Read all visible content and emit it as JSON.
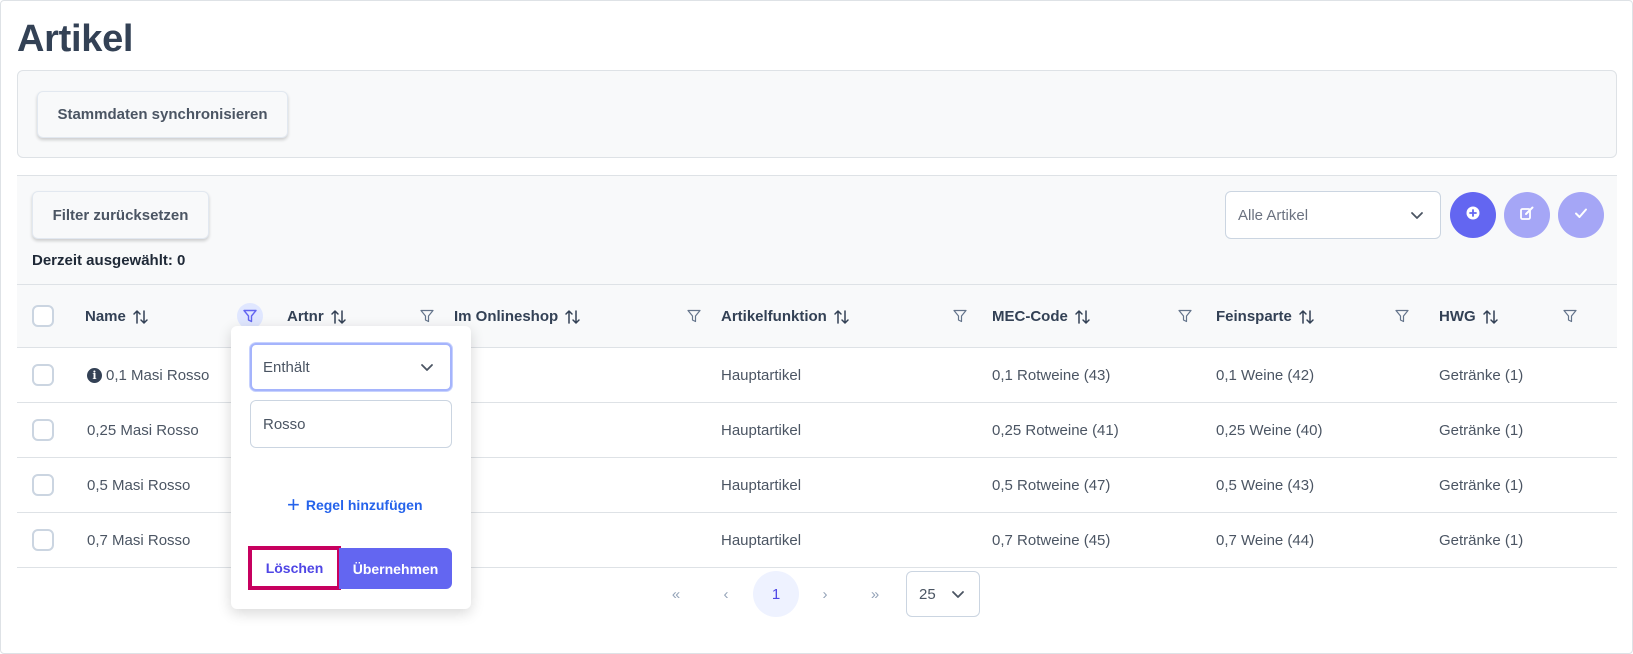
{
  "page": {
    "title": "Artikel"
  },
  "toolbar": {
    "sync_label": "Stammdaten synchronisieren"
  },
  "table_controls": {
    "reset_filter_label": "Filter zurücksetzen",
    "selected_text": "Derzeit ausgewählt: 0",
    "view_select": {
      "value": "Alle Artikel"
    },
    "action_buttons": [
      "add-icon",
      "edit-icon",
      "check-icon"
    ]
  },
  "columns": [
    {
      "key": "name",
      "label": "Name"
    },
    {
      "key": "artnr",
      "label": "Artnr"
    },
    {
      "key": "onlineshop",
      "label": "Im Onlineshop"
    },
    {
      "key": "funktion",
      "label": "Artikelfunktion"
    },
    {
      "key": "mec",
      "label": "MEC-Code"
    },
    {
      "key": "feinsparte",
      "label": "Feinsparte"
    },
    {
      "key": "hwg",
      "label": "HWG"
    }
  ],
  "rows": [
    {
      "name": "0,1 Masi Rosso",
      "has_info": true,
      "artnr": "",
      "onlineshop": "",
      "funktion": "Hauptartikel",
      "mec": "0,1 Rotweine (43)",
      "feinsparte": "0,1 Weine (42)",
      "hwg": "Getränke (1)"
    },
    {
      "name": "0,25 Masi Rosso",
      "has_info": false,
      "artnr": "",
      "onlineshop": "",
      "funktion": "Hauptartikel",
      "mec": "0,25 Rotweine (41)",
      "feinsparte": "0,25 Weine (40)",
      "hwg": "Getränke (1)"
    },
    {
      "name": "0,5 Masi Rosso",
      "has_info": false,
      "artnr": "",
      "onlineshop": "",
      "funktion": "Hauptartikel",
      "mec": "0,5 Rotweine (47)",
      "feinsparte": "0,5 Weine (43)",
      "hwg": "Getränke (1)"
    },
    {
      "name": "0,7 Masi Rosso",
      "has_info": false,
      "artnr": "",
      "onlineshop": "",
      "funktion": "Hauptartikel",
      "mec": "0,7 Rotweine (45)",
      "feinsparte": "0,7 Weine (44)",
      "hwg": "Getränke (1)"
    }
  ],
  "pagination": {
    "first": "«",
    "prev": "‹",
    "current_page": "1",
    "next": "›",
    "last": "»",
    "page_size": "25"
  },
  "filter_popover": {
    "match_mode": "Enthält",
    "value": "Rosso",
    "add_rule_label": "Regel hinzufügen",
    "clear_label": "Löschen",
    "apply_label": "Übernehmen"
  },
  "colors": {
    "primary": "#6366f1",
    "primary_light": "#a5a6f6",
    "highlight_border": "#c7005f",
    "link": "#2563eb"
  }
}
